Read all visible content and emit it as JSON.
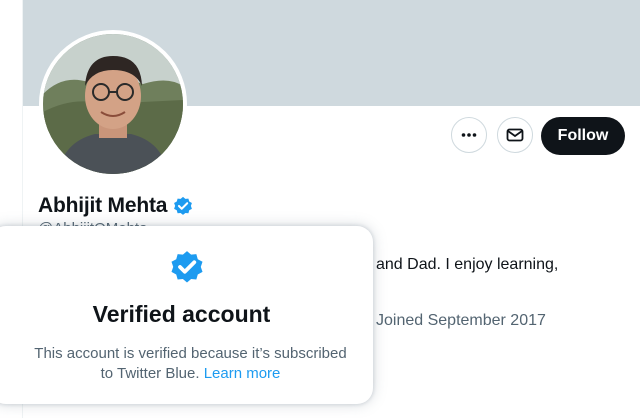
{
  "profile": {
    "name": "Abhijit Mehta",
    "handle": "@AbhijitOMehta",
    "bio_fragment": "and Dad. I enjoy learning,",
    "joined": "Joined September 2017"
  },
  "actions": {
    "more_icon": "more-horizontal-icon",
    "message_icon": "envelope-icon",
    "follow_label": "Follow"
  },
  "verified_popover": {
    "title": "Verified account",
    "description_line1": "This account is verified because it’s subscribed",
    "description_line2": "to Twitter Blue.",
    "link_label": "Learn more"
  },
  "colors": {
    "brand_blue": "#1d9bf0",
    "banner": "#cfd9de",
    "follow_bg": "#0f1419",
    "secondary_text": "#536471"
  }
}
